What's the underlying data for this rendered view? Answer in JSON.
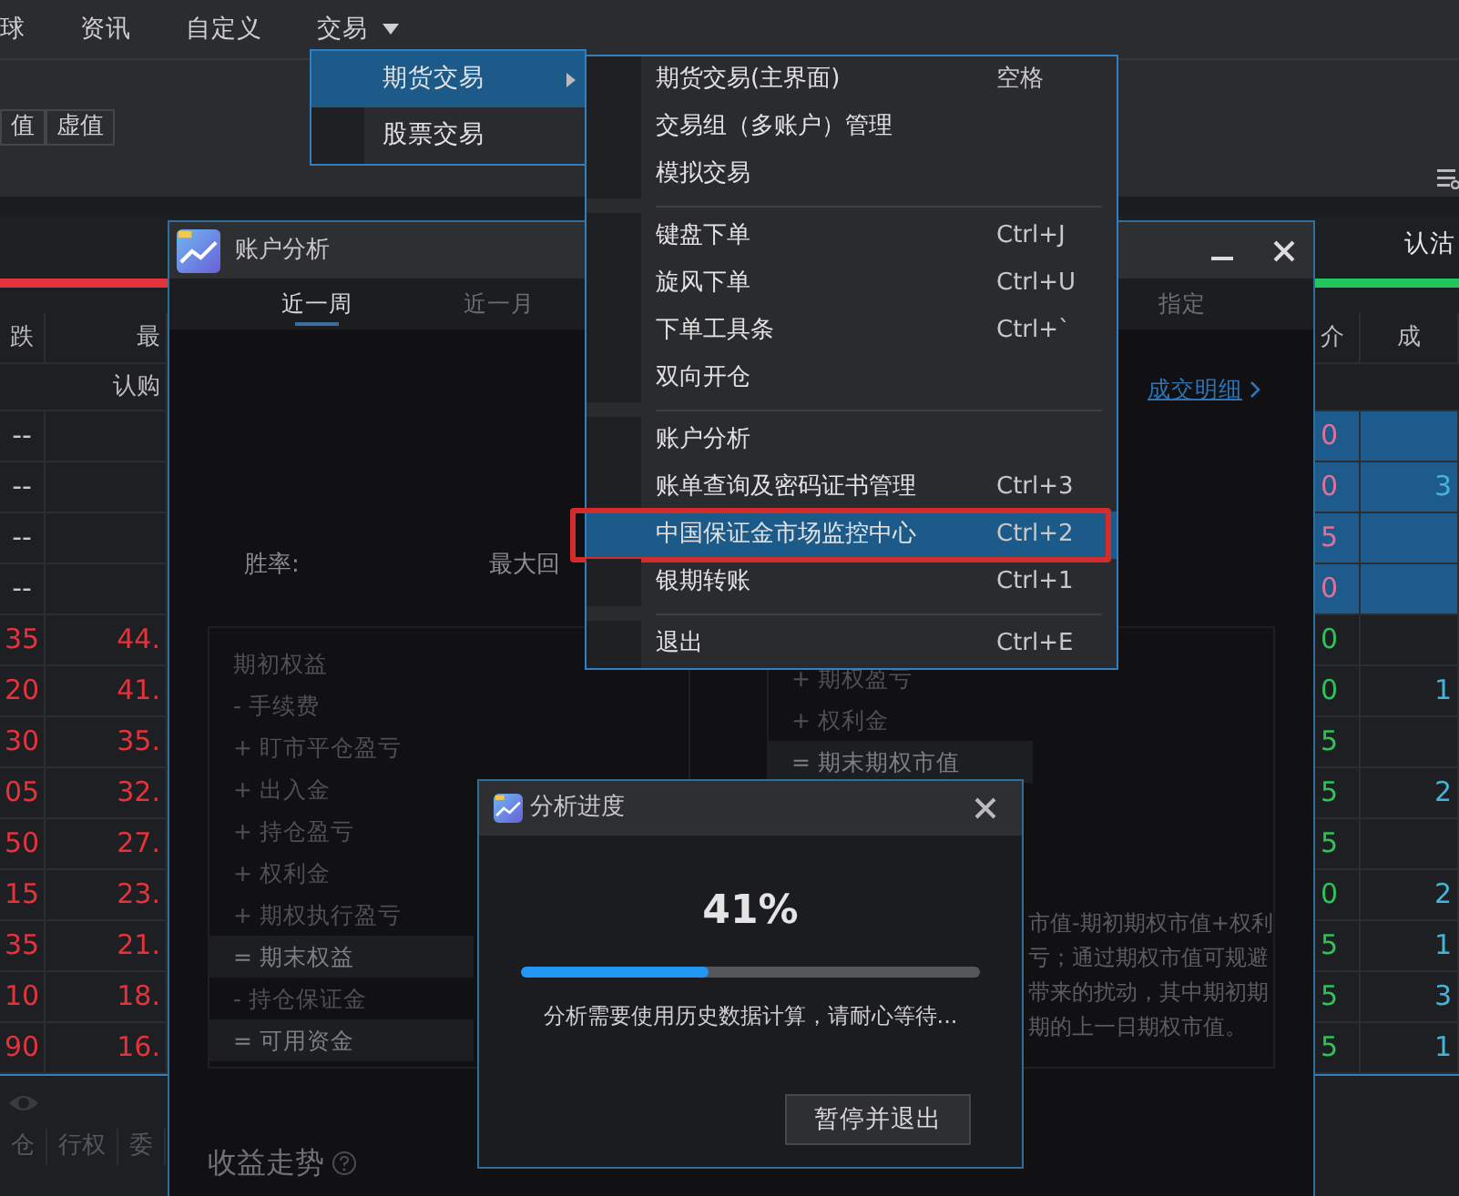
{
  "menu_bar": [
    {
      "label": "球",
      "dropdown": false
    },
    {
      "label": "资讯",
      "dropdown": false
    },
    {
      "label": "自定义",
      "dropdown": false
    },
    {
      "label": "交易",
      "dropdown": true
    }
  ],
  "toolbar": {
    "buttons": [
      "值",
      "虚值"
    ]
  },
  "call_table": {
    "columns": [
      "跌",
      "最"
    ],
    "group": "认购",
    "rows": [
      {
        "change": "--",
        "color": "#c8c8c8"
      },
      {
        "change": "--",
        "color": "#c8c8c8"
      },
      {
        "change": "--",
        "color": "#c8c8c8"
      },
      {
        "change": "--",
        "color": "#c8c8c8"
      },
      {
        "change": "35",
        "last": "44.",
        "color": "#e5333b"
      },
      {
        "change": "20",
        "last": "41.",
        "color": "#e5333b"
      },
      {
        "change": "30",
        "last": "35.",
        "color": "#e5333b"
      },
      {
        "change": "05",
        "last": "32.",
        "color": "#e5333b"
      },
      {
        "change": "50",
        "last": "27.",
        "color": "#e5333b"
      },
      {
        "change": "15",
        "last": "23.",
        "color": "#e5333b"
      },
      {
        "change": "35",
        "last": "21.",
        "color": "#e5333b"
      },
      {
        "change": "10",
        "last": "18.",
        "color": "#e5333b"
      },
      {
        "change": "90",
        "last": "16.",
        "color": "#e5333b"
      }
    ]
  },
  "bottom_tabs": [
    "仓",
    "行权",
    "委"
  ],
  "put_table": {
    "title": "认沽",
    "columns": [
      "介",
      "成"
    ],
    "rows": [
      {
        "price": "0",
        "highlighted": true,
        "color": "#e0709a"
      },
      {
        "price": "0",
        "volume": "3",
        "highlighted": true,
        "color": "#e0709a"
      },
      {
        "price": "5",
        "highlighted": true,
        "color": "#e0709a"
      },
      {
        "price": "0",
        "highlighted": true,
        "color": "#e0709a"
      },
      {
        "price": "0",
        "highlighted": false,
        "color": "#2fc25b"
      },
      {
        "price": "0",
        "volume": "1",
        "highlighted": false,
        "color": "#2fc25b"
      },
      {
        "price": "5",
        "highlighted": false,
        "color": "#2fc25b"
      },
      {
        "price": "5",
        "volume": "2",
        "highlighted": false,
        "color": "#2fc25b"
      },
      {
        "price": "5",
        "highlighted": false,
        "color": "#2fc25b"
      },
      {
        "price": "0",
        "volume": "2",
        "highlighted": false,
        "color": "#2fc25b"
      },
      {
        "price": "5",
        "volume": "1",
        "highlighted": false,
        "color": "#2fc25b"
      },
      {
        "price": "5",
        "volume": "3",
        "highlighted": false,
        "color": "#2fc25b"
      },
      {
        "price": "5",
        "volume": "1",
        "highlighted": false,
        "color": "#2fc25b"
      }
    ]
  },
  "account_window": {
    "title": "账户分析",
    "tabs": [
      {
        "label": "近一周",
        "selected": true
      },
      {
        "label": "近一月",
        "selected": false
      },
      {
        "label": "指定",
        "selected": false
      }
    ],
    "detail_link": "成交明细",
    "stats": [
      "胜率:",
      "最大回"
    ],
    "equity_items": [
      {
        "text": "期初权益",
        "highlighted": false
      },
      {
        "text": "- 手续费",
        "highlighted": false
      },
      {
        "text": "+ 盯市平仓盈亏",
        "highlighted": false
      },
      {
        "text": "+ 出入金",
        "highlighted": false
      },
      {
        "text": "+ 持仓盈亏",
        "highlighted": false
      },
      {
        "text": "+ 权利金",
        "highlighted": false
      },
      {
        "text": "+ 期权执行盈亏",
        "highlighted": false
      },
      {
        "text": "= 期末权益",
        "highlighted": true
      },
      {
        "text": "- 持仓保证金",
        "highlighted": false
      },
      {
        "text": "= 可用资金",
        "highlighted": true
      }
    ],
    "option_items": [
      {
        "text": "+ 期权盈亏",
        "highlighted": false
      },
      {
        "text": "+ 权利金",
        "highlighted": false
      },
      {
        "text": "= 期末期权市值",
        "highlighted": true
      }
    ],
    "note_lines": [
      "市值-期初期权市值+权利",
      "亏；通过期权市值可规避",
      "带来的扰动，其中期初期",
      "期的上一日期权市值。"
    ],
    "chart_title": "收益走势"
  },
  "trade_menu": [
    {
      "label": "期货交易",
      "selected": true,
      "submenu": true
    },
    {
      "label": "股票交易",
      "selected": false,
      "submenu": false
    }
  ],
  "futures_submenu": [
    [
      {
        "label": "期货交易(主界面)",
        "shortcut": "空格",
        "selected": false,
        "outlined": false
      },
      {
        "label": "交易组（多账户）管理",
        "selected": false,
        "outlined": false
      },
      {
        "label": "模拟交易",
        "selected": false,
        "outlined": false
      }
    ],
    [
      {
        "label": "键盘下单",
        "shortcut": "Ctrl+J",
        "selected": false,
        "outlined": false
      },
      {
        "label": "旋风下单",
        "shortcut": "Ctrl+U",
        "selected": false,
        "outlined": false
      },
      {
        "label": "下单工具条",
        "shortcut": "Ctrl+`",
        "selected": false,
        "outlined": false
      },
      {
        "label": "双向开仓",
        "selected": false,
        "outlined": false
      }
    ],
    [
      {
        "label": "账户分析",
        "selected": false,
        "outlined": false
      },
      {
        "label": "账单查询及密码证书管理",
        "shortcut": "Ctrl+3",
        "selected": false,
        "outlined": false
      },
      {
        "label": "中国保证金市场监控中心",
        "shortcut": "Ctrl+2",
        "selected": true,
        "outlined": true
      },
      {
        "label": "银期转账",
        "shortcut": "Ctrl+1",
        "selected": false,
        "outlined": false
      }
    ],
    [
      {
        "label": "退出",
        "shortcut": "Ctrl+E",
        "selected": false,
        "outlined": false
      }
    ]
  ],
  "progress_dialog": {
    "title": "分析进度",
    "percent": "41%",
    "level": 0.41,
    "message": "分析需要使用历史数据计算，请耐心等待...",
    "button": "暂停并退出"
  }
}
